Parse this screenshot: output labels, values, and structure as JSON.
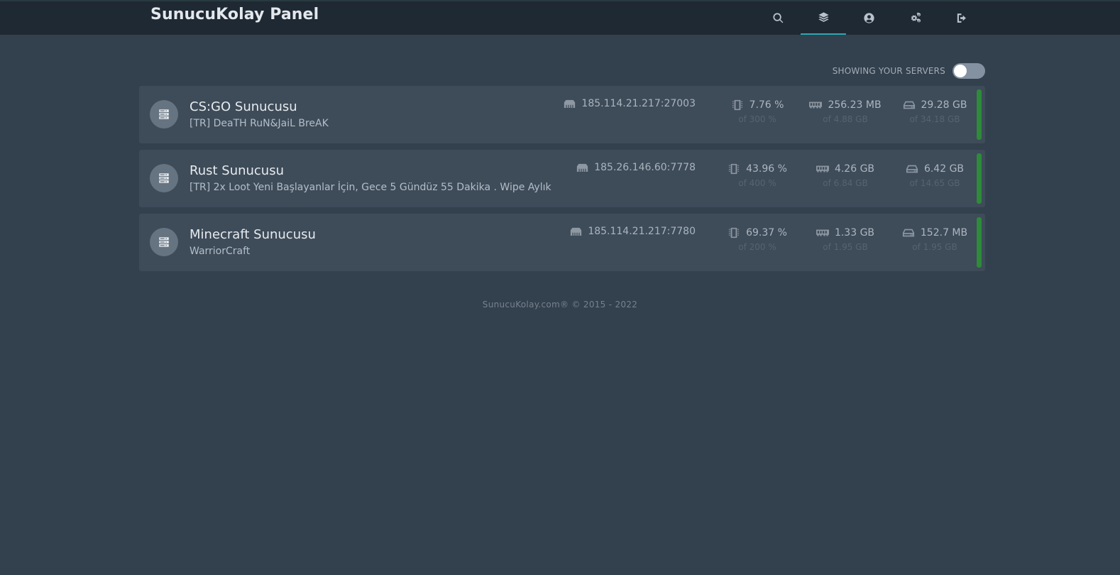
{
  "header": {
    "brand": "SunucuKolay Panel",
    "nav": [
      {
        "id": "search",
        "icon": "search-icon"
      },
      {
        "id": "servers",
        "icon": "layers-icon",
        "active": true
      },
      {
        "id": "account",
        "icon": "user-circle-icon"
      },
      {
        "id": "admin",
        "icon": "cogs-icon"
      },
      {
        "id": "logout",
        "icon": "sign-out-icon"
      }
    ]
  },
  "filter": {
    "label": "SHOWING YOUR SERVERS",
    "toggle_on": false
  },
  "servers": [
    {
      "name": "CS:GO Sunucusu",
      "description": "[TR] DeaTH RuN&JaiL BreAK",
      "address": "185.114.21.217:27003",
      "cpu": "7.76 %",
      "cpu_limit": "of 300 %",
      "memory": "256.23 MB",
      "memory_limit": "of 4.88 GB",
      "disk": "29.28 GB",
      "disk_limit": "of 34.18 GB",
      "status_color": "#2f8a3a"
    },
    {
      "name": "Rust Sunucusu",
      "description": "[TR] 2x Loot Yeni Başlayanlar İçin, Gece 5 Gündüz 55 Dakika . Wipe Aylık",
      "address": "185.26.146.60:7778",
      "cpu": "43.96 %",
      "cpu_limit": "of 400 %",
      "memory": "4.26 GB",
      "memory_limit": "of 6.84 GB",
      "disk": "6.42 GB",
      "disk_limit": "of 14.65 GB",
      "status_color": "#2f8a3a"
    },
    {
      "name": "Minecraft Sunucusu",
      "description": "WarriorCraft",
      "address": "185.114.21.217:7780",
      "cpu": "69.37 %",
      "cpu_limit": "of 200 %",
      "memory": "1.33 GB",
      "memory_limit": "of 1.95 GB",
      "disk": "152.7 MB",
      "disk_limit": "of 1.95 GB",
      "status_color": "#2f8a3a"
    }
  ],
  "footer": {
    "text": "SunucuKolay.com® © 2015 - 2022"
  },
  "colors": {
    "background": "#33404d",
    "topbar": "#1f2933",
    "card": "#3e4b59",
    "accent": "#2fa6b4",
    "status_online": "#2f8a3a"
  }
}
